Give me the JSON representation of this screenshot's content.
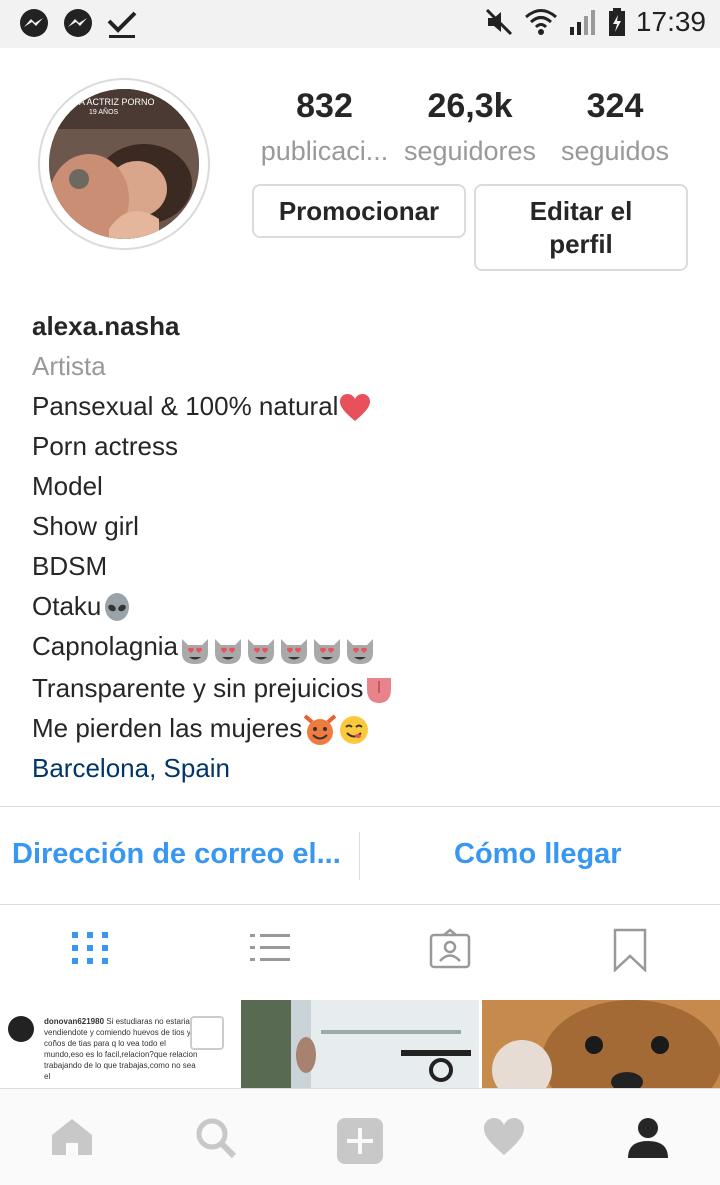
{
  "status_bar": {
    "time": "17:39",
    "icons": [
      "messenger-icon",
      "messenger-icon",
      "download-done-icon",
      "mute-icon",
      "wifi-icon",
      "signal-icon",
      "battery-charging-icon"
    ]
  },
  "profile": {
    "stats": [
      {
        "value": "832",
        "label": "publicaci..."
      },
      {
        "value": "26,3k",
        "label": "seguidores"
      },
      {
        "value": "324",
        "label": "seguidos"
      }
    ],
    "avatar_caption": "A ACTRIZ PORNO",
    "avatar_sub": "19 AÑOS",
    "promote_label": "Promocionar",
    "edit_label_line1": "Editar el",
    "edit_label_line2": "perfil"
  },
  "bio": {
    "username": "alexa.nasha",
    "category": "Artista",
    "lines": [
      "Pansexual & 100% natural",
      "Porn actress",
      "Model",
      "Show girl",
      "BDSM",
      "Otaku",
      "Capnolagnia",
      "Transparente y sin prejuicios",
      "Me pierden las mujeres"
    ],
    "location": "Barcelona, Spain"
  },
  "contact": {
    "email_label": "Dirección de correo el...",
    "directions_label": "Cómo llegar"
  },
  "tabs": [
    "grid-icon",
    "list-icon",
    "tagged-icon",
    "saved-icon"
  ],
  "grid": {
    "post1_user": "donovan621980",
    "post1_text": "Si estudiaras no estarias vendiendote y comiendo huevos de tios y coños de tias para q lo vea todo el mundo,eso es lo facil,relacion?que relacion trabajando de lo que trabajas,como no sea el"
  },
  "bottom_nav": [
    "home-icon",
    "search-icon",
    "add-icon",
    "heart-icon",
    "profile-icon"
  ],
  "colors": {
    "link_blue": "#3897f0",
    "location_blue": "#003569",
    "muted_gray": "#999999",
    "border_gray": "#dbdbdb"
  }
}
